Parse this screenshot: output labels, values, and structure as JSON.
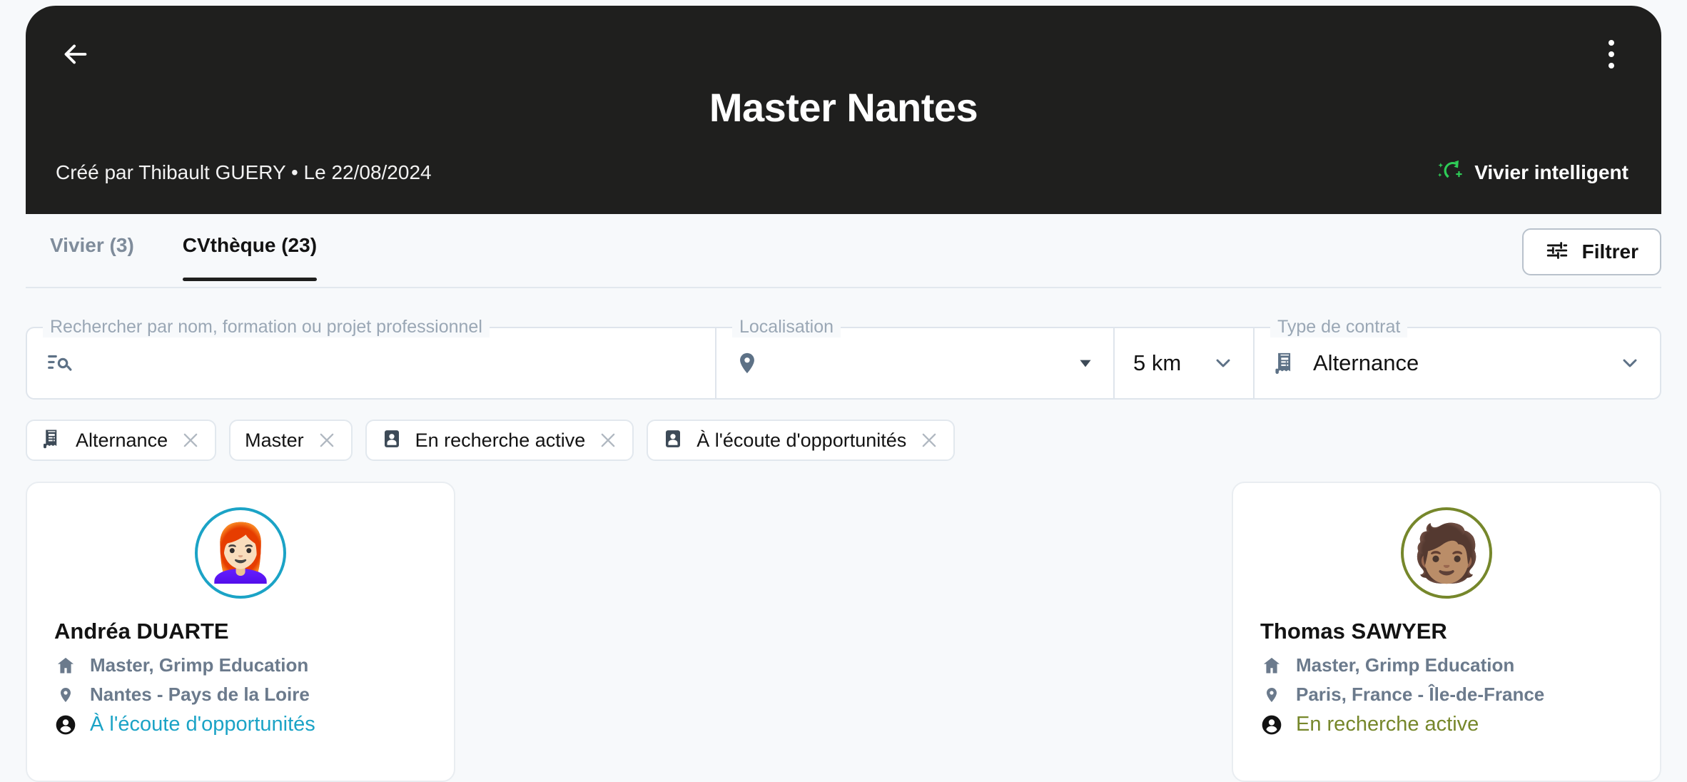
{
  "header": {
    "back_icon": "arrow-left-icon",
    "menu_icon": "kebab-menu-icon",
    "title": "Master Nantes",
    "meta": "Créé par Thibault GUERY • Le 22/08/2024",
    "smart_pool_label": "Vivier intelligent",
    "smart_pool_icon": "sparkle-arrow-icon",
    "smart_pool_color": "#2ecc57",
    "background": "#1f1f1e"
  },
  "tabs": [
    {
      "label": "Vivier (3)",
      "active": false
    },
    {
      "label": "CVthèque (23)",
      "active": true
    }
  ],
  "filter_button": {
    "label": "Filtrer",
    "icon": "tune-icon"
  },
  "fields": {
    "search": {
      "legend": "Rechercher par nom, formation ou projet professionnel",
      "value": "",
      "placeholder": "",
      "icon": "manage-search-icon"
    },
    "location": {
      "legend": "Localisation",
      "value": "",
      "icon": "location-pin-icon",
      "caret": "triangle-down-icon"
    },
    "radius": {
      "value": "5 km",
      "caret": "chevron-down-icon"
    },
    "contract": {
      "legend": "Type de contrat",
      "value": "Alternance",
      "icon": "receipt-icon",
      "caret": "chevron-down-icon"
    }
  },
  "chips": [
    {
      "label": "Alternance",
      "icon": "receipt-icon",
      "close_icon": "close-icon"
    },
    {
      "label": "Master",
      "icon": null,
      "close_icon": "close-icon"
    },
    {
      "label": "En recherche active",
      "icon": "badge-person-icon",
      "close_icon": "close-icon"
    },
    {
      "label": "À l'écoute d'opportunités",
      "icon": "badge-person-icon",
      "close_icon": "close-icon"
    }
  ],
  "candidates": [
    {
      "avatar_emoji": "👩🏻‍🦰",
      "ring_color": "#1ba3c6",
      "name": "Andréa DUARTE",
      "education": "Master, Grimp Education",
      "location": "Nantes - Pays de la Loire",
      "status": "À l'écoute d'opportunités",
      "status_color": "#1ba3c6",
      "education_icon": "school-house-icon",
      "location_icon": "location-pin-icon",
      "status_icon": "account-circle-icon"
    },
    {
      "avatar_emoji": "🧑🏽",
      "ring_color": "#76872b",
      "name": "Thomas SAWYER",
      "education": "Master, Grimp Education",
      "location": "Paris, France - Île-de-France",
      "status": "En recherche active",
      "status_color": "#76872b",
      "education_icon": "school-house-icon",
      "location_icon": "location-pin-icon",
      "status_icon": "account-circle-icon"
    }
  ]
}
